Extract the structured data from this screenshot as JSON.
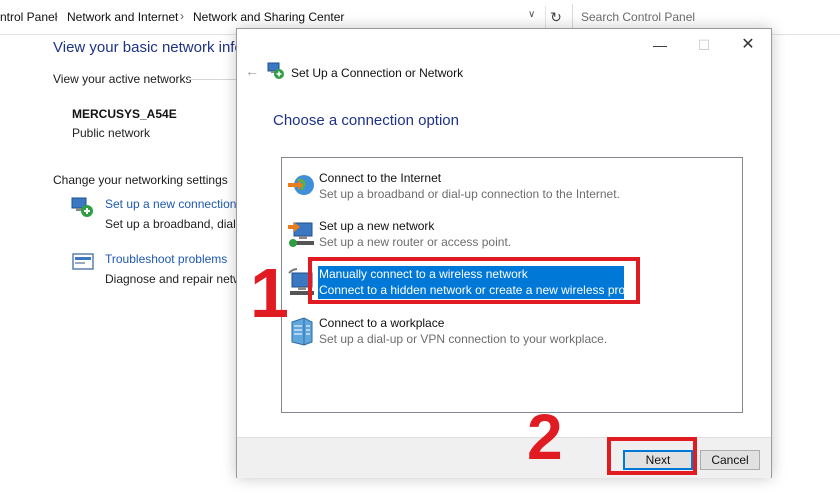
{
  "address_bar": {
    "breadcrumbs": [
      "ntrol Panel",
      "Network and Internet",
      "Network and Sharing Center"
    ],
    "search_placeholder": "Search Control Panel"
  },
  "background": {
    "title": "View your basic network info",
    "active_networks_label": "View your active networks",
    "network_name": "MERCUSYS_A54E",
    "network_type": "Public network",
    "change_settings_label": "Change your networking settings",
    "tasks": [
      {
        "link": "Set up a new connection or",
        "desc": "Set up a broadband, dial-u",
        "icon": "network-setup-icon"
      },
      {
        "link": "Troubleshoot problems",
        "desc": "Diagnose and repair netwo",
        "icon": "troubleshoot-icon"
      }
    ]
  },
  "dialog": {
    "title": "Set Up a Connection or Network",
    "heading": "Choose a connection option",
    "options": [
      {
        "title": "Connect to the Internet",
        "desc": "Set up a broadband or dial-up connection to the Internet.",
        "icon": "internet-globe-icon",
        "selected": false
      },
      {
        "title": "Set up a new network",
        "desc": "Set up a new router or access point.",
        "icon": "new-network-icon",
        "selected": false
      },
      {
        "title": "Manually connect to a wireless network",
        "desc": "Connect to a hidden network or create a new wireless profile.",
        "icon": "wireless-network-icon",
        "selected": true
      },
      {
        "title": "Connect to a workplace",
        "desc": "Set up a dial-up or VPN connection to your workplace.",
        "icon": "workplace-icon",
        "selected": false
      }
    ],
    "next_label": "Next",
    "cancel_label": "Cancel"
  },
  "annotations": {
    "step1": "1",
    "step2": "2",
    "highlight_color": "#e01b22"
  },
  "colors": {
    "selection": "#0078d7",
    "heading": "#1e3287",
    "link": "#1e59b0"
  }
}
